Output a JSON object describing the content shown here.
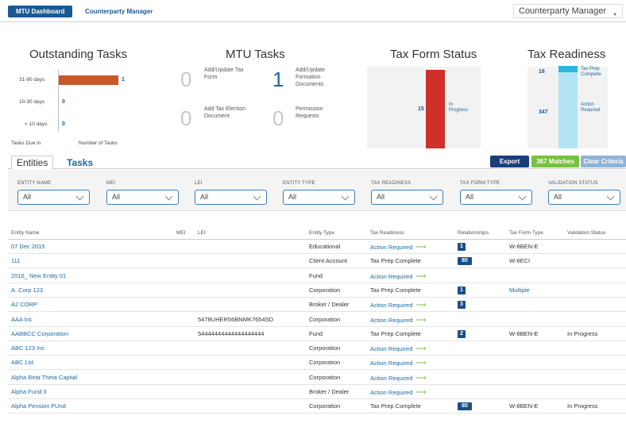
{
  "topbar": {
    "tab_dashboard": "MTU Dashboard",
    "tab_counterparty": "Counterparty Manager",
    "app_switch": "Counterparty Manager"
  },
  "outstanding": {
    "title": "Outstanding Tasks",
    "rows": [
      {
        "label": "31-90 days",
        "value": "1"
      },
      {
        "label": "10-30 days",
        "value": "0"
      },
      {
        "label": "< 10 days",
        "value": "0"
      }
    ],
    "xlabel_left": "Tasks Due in",
    "xlabel_right": "Number of Tasks"
  },
  "mtu": {
    "title": "MTU Tasks",
    "items": [
      {
        "value": "0",
        "label": "Add/Update Tax Form"
      },
      {
        "value": "1",
        "label": "Add/Update Formation Documents"
      },
      {
        "value": "0",
        "label": "Add Tax Election Document"
      },
      {
        "value": "0",
        "label": "Permission Requests"
      }
    ]
  },
  "taxform": {
    "title": "Tax Form Status",
    "value": "15",
    "label": "In Progress"
  },
  "readiness": {
    "title": "Tax Readiness",
    "top_value": "16",
    "top_label": "Tax Prep Complete",
    "bottom_value": "347",
    "bottom_label": "Action Required"
  },
  "chart_data": [
    {
      "type": "bar",
      "title": "Outstanding Tasks",
      "categories": [
        "31-90 days",
        "10-30 days",
        "< 10 days"
      ],
      "values": [
        1,
        0,
        0
      ],
      "xlabel": "Number of Tasks",
      "ylabel": "Tasks Due in"
    },
    {
      "type": "bar",
      "title": "Tax Form Status",
      "categories": [
        "In Progress"
      ],
      "values": [
        15
      ]
    },
    {
      "type": "bar",
      "title": "Tax Readiness",
      "categories": [
        "Tax Prep Complete",
        "Action Required"
      ],
      "values": [
        16,
        347
      ]
    }
  ],
  "actions": {
    "export": "Export",
    "matches": "367 Matches",
    "clear": "Clear Criteria"
  },
  "tabs": {
    "entities": "Entities",
    "tasks": "Tasks"
  },
  "filters": [
    {
      "label": "ENTITY NAME",
      "value": "All"
    },
    {
      "label": "MEI",
      "value": "All"
    },
    {
      "label": "LEI",
      "value": "All"
    },
    {
      "label": "ENTITY TYPE",
      "value": "All"
    },
    {
      "label": "TAX READINESS",
      "value": "All"
    },
    {
      "label": "TAX FORM TYPE",
      "value": "All"
    },
    {
      "label": "VALIDATION STATUS",
      "value": "All"
    }
  ],
  "table": {
    "headers": {
      "name": "Entity Name",
      "mei": "MEI",
      "lei": "LEI",
      "type": "Entity Type",
      "tax": "Tax Readiness",
      "rel": "Relationships",
      "tft": "Tax Form Type",
      "val": "Validation Status"
    },
    "rows": [
      {
        "name": "07 Dec 2015",
        "lei": "",
        "type": "Educational",
        "tax": "Action Required",
        "rel": "1",
        "tft": "W-8BEN-E",
        "val": ""
      },
      {
        "name": "111",
        "lei": "",
        "type": "Client Account",
        "tax": "Tax Prep Complete",
        "rel": "80",
        "tft": "W-8ECI",
        "val": ""
      },
      {
        "name": "2016_ New Entity 01",
        "lei": "",
        "type": "Fund",
        "tax": "Action Required",
        "rel": "",
        "tft": "",
        "val": ""
      },
      {
        "name": "A. Corp 123",
        "lei": "",
        "type": "Corporation",
        "tax": "Tax Prep Complete",
        "rel": "1",
        "tft": "Multiple",
        "val": ""
      },
      {
        "name": "A2 CORP",
        "lei": "",
        "type": "Broker / Dealer",
        "tax": "Action Required",
        "rel": "3",
        "tft": "",
        "val": ""
      },
      {
        "name": "AAA Inc",
        "lei": "5478UHER56BNMK7654SD",
        "type": "Corporation",
        "tax": "Action Required",
        "rel": "",
        "tft": "",
        "val": ""
      },
      {
        "name": "AABBCC Corporation",
        "lei": "54444444444444444444",
        "type": "Fund",
        "tax": "Tax Prep Complete",
        "rel": "2",
        "tft": "W-8BEN-E",
        "val": "In Progress"
      },
      {
        "name": "ABC 123 Inc",
        "lei": "",
        "type": "Corporation",
        "tax": "Action Required",
        "rel": "",
        "tft": "",
        "val": ""
      },
      {
        "name": "ABC Ltd",
        "lei": "",
        "type": "Corporation",
        "tax": "Action Required",
        "rel": "",
        "tft": "",
        "val": ""
      },
      {
        "name": "Alpha Beta Theta Capital",
        "lei": "",
        "type": "Corporation",
        "tax": "Action Required",
        "rel": "",
        "tft": "",
        "val": ""
      },
      {
        "name": "Alpha Fund II",
        "lei": "",
        "type": "Broker / Dealer",
        "tax": "Action Required",
        "rel": "",
        "tft": "",
        "val": ""
      },
      {
        "name": "Alpha Pension FUnd",
        "lei": "",
        "type": "Corporation",
        "tax": "Tax Prep Complete",
        "rel": "80",
        "tft": "W-8BEN-E",
        "val": "In Progress"
      }
    ]
  },
  "colors": {
    "brand_blue": "#1a5a93",
    "orange_bar": "#c8582a",
    "red_bar": "#d0302a",
    "cyan_bar": "#29b6e0",
    "light_cyan_bar": "#b3e4f5",
    "green": "#7ac142"
  }
}
